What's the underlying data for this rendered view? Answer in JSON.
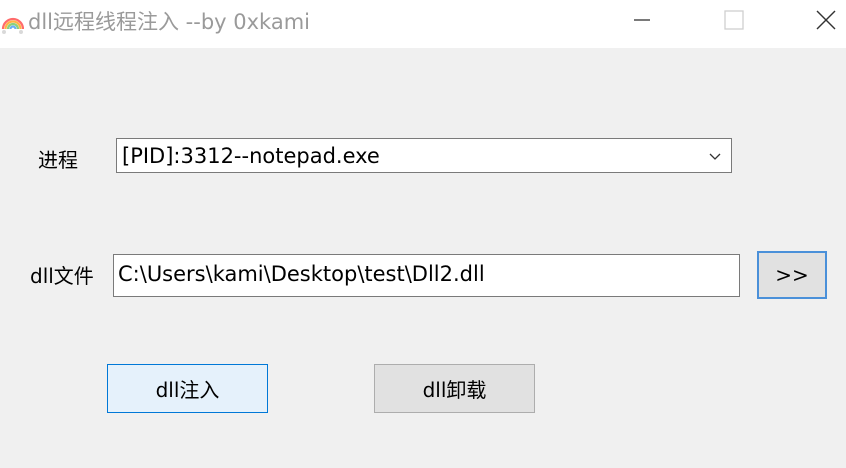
{
  "window": {
    "title": "dll远程线程注入 --by 0xkami",
    "app_icon": "rainbow-icon",
    "controls": [
      "minimize-icon",
      "maximize-icon",
      "close-icon"
    ]
  },
  "form": {
    "process_label": "进程",
    "process_value": "[PID]:3312--notepad.exe",
    "dll_label": "dll文件",
    "dll_path": "C:\\Users\\kami\\Desktop\\test\\Dll2.dll",
    "browse_label": ">>"
  },
  "actions": {
    "inject_label": "dll注入",
    "unload_label": "dll卸载"
  },
  "colors": {
    "background": "#f0f0f0",
    "titlebar": "#ffffff",
    "title_text": "#9a9a9a",
    "focus_border": "#0078d7",
    "button_face": "#e1e1e1",
    "button_hover": "#e5f1fb"
  }
}
